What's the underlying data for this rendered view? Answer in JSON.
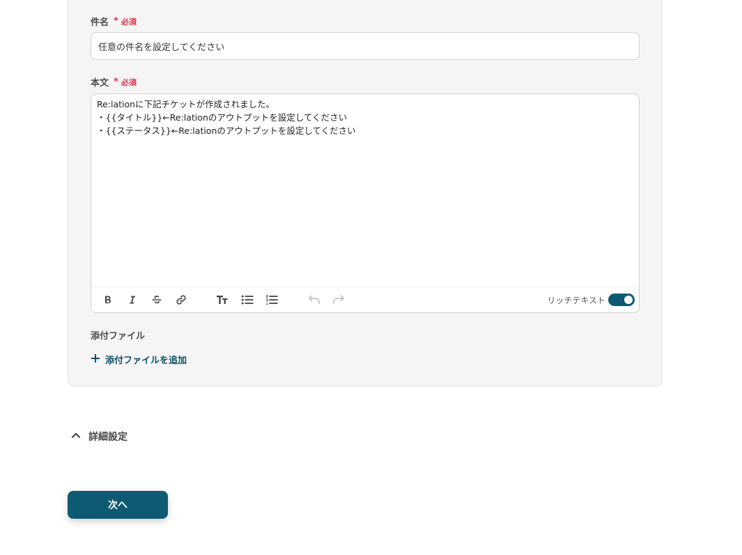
{
  "subject": {
    "label": "件名",
    "required_mark": "*",
    "required_text": "必須",
    "value": "任意の件名を設定してください"
  },
  "body": {
    "label": "本文",
    "required_mark": "*",
    "required_text": "必須",
    "lines": [
      "Re:lationに下記チケットが作成されました。",
      "・{{タイトル}}←Re:lationのアウトプットを設定してください",
      "・{{ステータス}}←Re:lationのアウトプットを設定してください"
    ],
    "rich_text_label": "リッチテキスト",
    "rich_text_enabled": true
  },
  "attachments": {
    "label": "添付ファイル",
    "add_label": "添付ファイルを追加"
  },
  "details": {
    "label": "詳細設定"
  },
  "next_button": {
    "label": "次へ"
  },
  "colors": {
    "accent": "#0d5a72",
    "required": "#e0334d"
  }
}
